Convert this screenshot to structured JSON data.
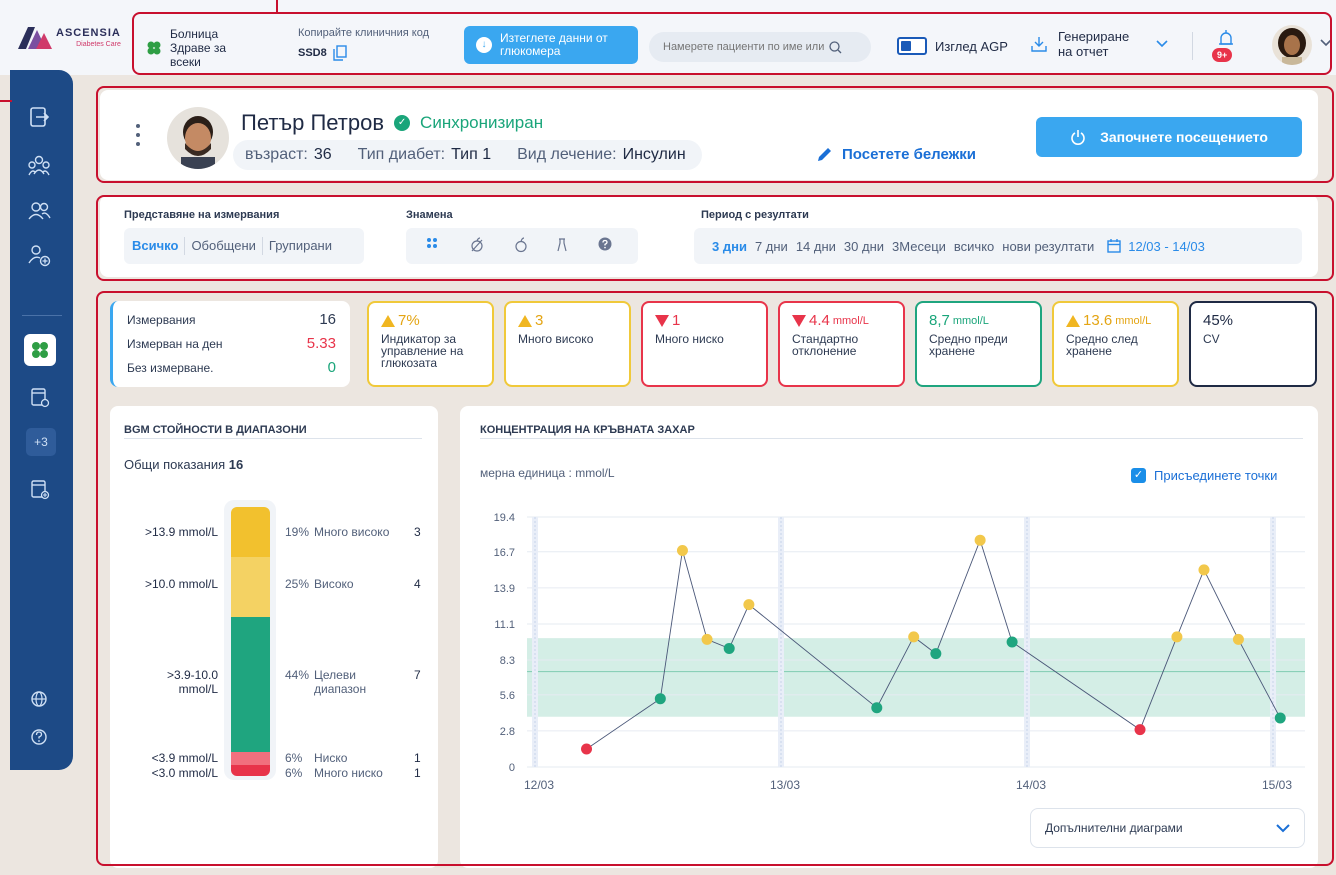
{
  "header": {
    "logo": {
      "line1": "ASCENSIA",
      "line2": "Diabetes Care"
    },
    "hospital": "Болница Здраве за всеки",
    "copy_code_label": "Копирайте клиничния код",
    "clinic_code": "SSD8",
    "download_label": "Изтеглете данни от глюкомера",
    "search_placeholder": "Намерете пациенти по име или",
    "agp_label": "Изглед AGP",
    "report_label": "Генериране на отчет",
    "notifications_badge": "9+"
  },
  "sidebar": {
    "more_label": "+3",
    "icons": [
      "logout-icon",
      "groups-icon",
      "users-icon",
      "add-user-icon",
      "clover-icon",
      "calendar-settings-icon",
      "calendar-add-icon",
      "globe-icon",
      "help-icon"
    ]
  },
  "patient": {
    "name": "Петър Петров",
    "status": "Синхронизиран",
    "age_label": "възраст:",
    "age": "36",
    "diabetes_label": "Тип диабет:",
    "diabetes": "Тип 1",
    "treatment_label": "Вид лечение:",
    "treatment": "Инсулин",
    "notes_label": "Посетете бележки",
    "start_label": "Започнете посещението"
  },
  "filters": {
    "view_title": "Представяне на измервания",
    "view_options": [
      "Всичко",
      "Обобщени",
      "Групирани"
    ],
    "flags_title": "Знамена",
    "period_title": "Период с резултати",
    "period_options": [
      "3 дни",
      "7 дни",
      "14 дни",
      "30 дни",
      "3Месеци",
      "всичко",
      "нови резултати"
    ],
    "date_range": "12/03 - 14/03"
  },
  "stats": {
    "measurements_label": "Измервания",
    "measurements": "16",
    "per_day_label": "Измерван на ден",
    "per_day": "5.33",
    "none_label": "Без измерване.",
    "none": "0",
    "gmi_value": "7%",
    "gmi_label": "Индикатор за управление на глюкозата",
    "very_high_value": "3",
    "very_high_label": "Много високо",
    "very_low_value": "1",
    "very_low_label": "Много ниско",
    "sd_value": "4.4",
    "sd_unit": "mmol/L",
    "sd_label": "Стандартно отклонение",
    "pre_value": "8,7",
    "pre_unit": "mmol/L",
    "pre_label": "Средно преди хранене",
    "post_value": "13.6",
    "post_unit": "mmol/L",
    "post_label": "Средно след хранене",
    "cv_value": "45%",
    "cv_label": "CV"
  },
  "bgm": {
    "title": "BGM СТОЙНОСТИ В ДИАПАЗОНИ",
    "total_label": "Общи показания",
    "total": "16",
    "rows": [
      {
        "range": ">13.9 mmol/L",
        "pct": "19%",
        "name": "Много високо",
        "count": "3"
      },
      {
        "range": ">10.0 mmol/L",
        "pct": "25%",
        "name": "Високо",
        "count": "4"
      },
      {
        "range": ">3.9-10.0 mmol/L",
        "pct": "44%",
        "name": "Целеви диапазон",
        "count": "7"
      },
      {
        "range": "<3.9 mmol/L",
        "pct": "6%",
        "name": "Ниско",
        "count": "1"
      },
      {
        "range": "<3.0 mmol/L",
        "pct": "6%",
        "name": "Много ниско",
        "count": "1"
      }
    ],
    "colors": {
      "very_high": "#f2c12e",
      "high": "#f4d263",
      "target": "#1fa57f",
      "low": "#f1707e",
      "very_low": "#e8344a"
    }
  },
  "chart": {
    "title": "КОНЦЕНТРАЦИЯ НА КРЪВНАТА ЗАХАР",
    "unit_label": "мерна единица : mmol/L",
    "join_label": "Присъединете точки",
    "more_charts": "Допълнителни диаграми"
  },
  "chart_data": {
    "type": "scatter",
    "title": "КОНЦЕНТРАЦИЯ НА КРЪВНАТА ЗАХАР",
    "ylabel": "мерна единица : mmol/L",
    "y_ticks": [
      0,
      2.8,
      5.6,
      8.3,
      11.1,
      13.9,
      16.7,
      19.4
    ],
    "ylim": [
      0,
      19.4
    ],
    "x_ticks": [
      "12/03",
      "13/03",
      "14/03",
      "15/03"
    ],
    "target_range": [
      3.9,
      10.0
    ],
    "target_line": 7.4,
    "points": [
      {
        "t": "12/03 14:00",
        "x": 0.12,
        "y": 1.4,
        "level": "very_low"
      },
      {
        "t": "12/03 21:00",
        "x": 0.42,
        "y": 5.3,
        "level": "target"
      },
      {
        "t": "13/03 02:00",
        "x": 0.51,
        "y": 16.8,
        "level": "high"
      },
      {
        "t": "13/03 08:00",
        "x": 0.61,
        "y": 9.9,
        "level": "high"
      },
      {
        "t": "13/03 11:00",
        "x": 0.7,
        "y": 9.2,
        "level": "target"
      },
      {
        "t": "13/03 13:00",
        "x": 0.78,
        "y": 12.6,
        "level": "high"
      },
      {
        "t": "13/03 18:00",
        "x": 1.3,
        "y": 4.6,
        "level": "target"
      },
      {
        "t": "14/03 01:00",
        "x": 1.45,
        "y": 10.1,
        "level": "high"
      },
      {
        "t": "14/03 05:00",
        "x": 1.54,
        "y": 8.8,
        "level": "target"
      },
      {
        "t": "14/03 09:00",
        "x": 1.72,
        "y": 17.6,
        "level": "very_high"
      },
      {
        "t": "14/03 12:00",
        "x": 1.85,
        "y": 9.7,
        "level": "target"
      },
      {
        "t": "14/03 20:00",
        "x": 2.37,
        "y": 2.9,
        "level": "very_low"
      },
      {
        "t": "14/03 22:00",
        "x": 2.52,
        "y": 10.1,
        "level": "high"
      },
      {
        "t": "15/03 02:00",
        "x": 2.63,
        "y": 15.3,
        "level": "high"
      },
      {
        "t": "15/03 05:00",
        "x": 2.77,
        "y": 9.9,
        "level": "high"
      },
      {
        "t": "15/03 09:00",
        "x": 2.94,
        "y": 3.8,
        "level": "target"
      }
    ],
    "join_points": true
  }
}
